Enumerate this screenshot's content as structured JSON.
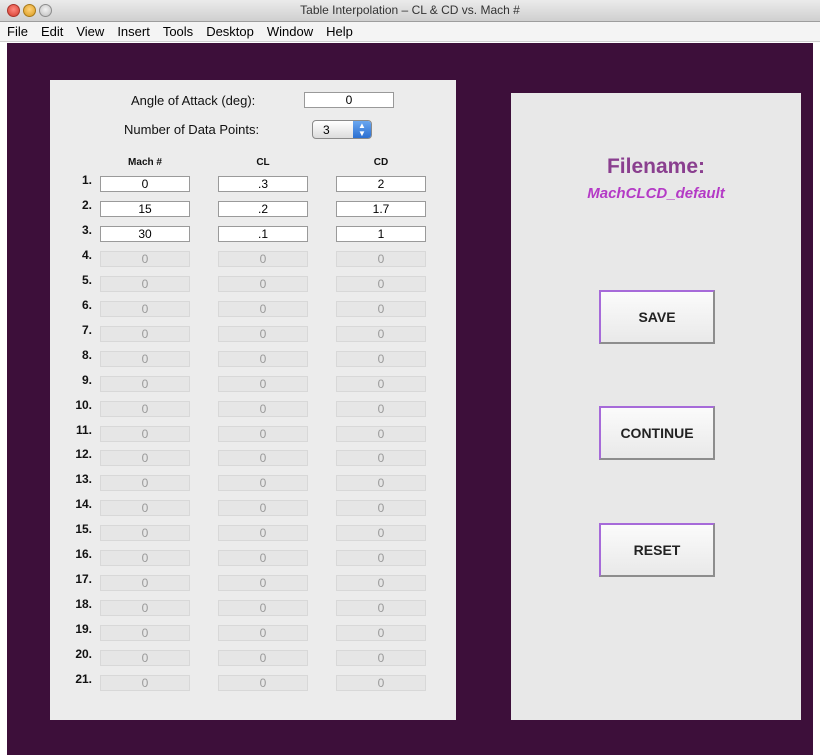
{
  "window": {
    "title": "Table Interpolation –  CL & CD vs. Mach #"
  },
  "menu": [
    "File",
    "Edit",
    "View",
    "Insert",
    "Tools",
    "Desktop",
    "Window",
    "Help"
  ],
  "left_panel": {
    "aoa_label": "Angle of Attack (deg):",
    "aoa_value": "0",
    "num_points_label": "Number of Data Points:",
    "num_points_value": "3",
    "columns": [
      "Mach #",
      "CL",
      "CD"
    ],
    "rows": [
      {
        "n": "1.",
        "mach": "0",
        "cl": ".3",
        "cd": "2",
        "active": true
      },
      {
        "n": "2.",
        "mach": "15",
        "cl": ".2",
        "cd": "1.7",
        "active": true
      },
      {
        "n": "3.",
        "mach": "30",
        "cl": ".1",
        "cd": "1",
        "active": true
      },
      {
        "n": "4.",
        "mach": "0",
        "cl": "0",
        "cd": "0",
        "active": false
      },
      {
        "n": "5.",
        "mach": "0",
        "cl": "0",
        "cd": "0",
        "active": false
      },
      {
        "n": "6.",
        "mach": "0",
        "cl": "0",
        "cd": "0",
        "active": false
      },
      {
        "n": "7.",
        "mach": "0",
        "cl": "0",
        "cd": "0",
        "active": false
      },
      {
        "n": "8.",
        "mach": "0",
        "cl": "0",
        "cd": "0",
        "active": false
      },
      {
        "n": "9.",
        "mach": "0",
        "cl": "0",
        "cd": "0",
        "active": false
      },
      {
        "n": "10.",
        "mach": "0",
        "cl": "0",
        "cd": "0",
        "active": false
      },
      {
        "n": "11.",
        "mach": "0",
        "cl": "0",
        "cd": "0",
        "active": false
      },
      {
        "n": "12.",
        "mach": "0",
        "cl": "0",
        "cd": "0",
        "active": false
      },
      {
        "n": "13.",
        "mach": "0",
        "cl": "0",
        "cd": "0",
        "active": false
      },
      {
        "n": "14.",
        "mach": "0",
        "cl": "0",
        "cd": "0",
        "active": false
      },
      {
        "n": "15.",
        "mach": "0",
        "cl": "0",
        "cd": "0",
        "active": false
      },
      {
        "n": "16.",
        "mach": "0",
        "cl": "0",
        "cd": "0",
        "active": false
      },
      {
        "n": "17.",
        "mach": "0",
        "cl": "0",
        "cd": "0",
        "active": false
      },
      {
        "n": "18.",
        "mach": "0",
        "cl": "0",
        "cd": "0",
        "active": false
      },
      {
        "n": "19.",
        "mach": "0",
        "cl": "0",
        "cd": "0",
        "active": false
      },
      {
        "n": "20.",
        "mach": "0",
        "cl": "0",
        "cd": "0",
        "active": false
      },
      {
        "n": "21.",
        "mach": "0",
        "cl": "0",
        "cd": "0",
        "active": false
      }
    ]
  },
  "right_panel": {
    "filename_label": "Filename:",
    "filename_value": "MachCLCD_default",
    "buttons": {
      "save": "SAVE",
      "continue": "CONTINUE",
      "reset": "RESET"
    }
  },
  "colors": {
    "figure_bg": "#3d0f3a",
    "panel_bg": "#ececec",
    "filename_label": "#8a3f8f",
    "filename_value": "#b43ac6",
    "button_border": "#a66ad9"
  }
}
